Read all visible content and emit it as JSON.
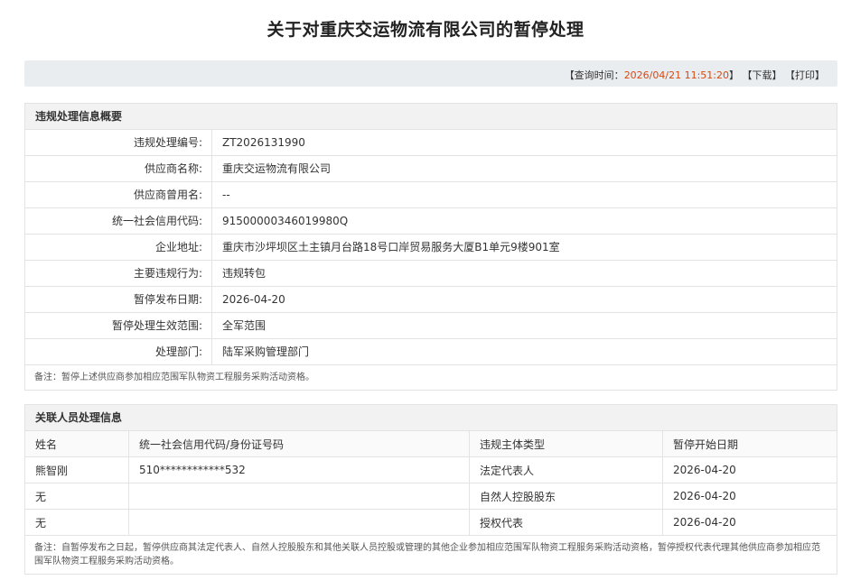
{
  "page": {
    "title": "关于对重庆交运物流有限公司的暂停处理"
  },
  "toolbar": {
    "query_label": "【查询时间：",
    "query_time": "2026/04/21 11:51:20",
    "query_close": "】",
    "download_label": "【下载】",
    "print_label": "【打印】"
  },
  "overview": {
    "heading": "违规处理信息概要",
    "rows": [
      {
        "label": "违规处理编号:",
        "value": "ZT2026131990"
      },
      {
        "label": "供应商名称:",
        "value": "重庆交运物流有限公司"
      },
      {
        "label": "供应商曾用名:",
        "value": "--"
      },
      {
        "label": "统一社会信用代码:",
        "value": "91500000346019980Q"
      },
      {
        "label": "企业地址:",
        "value": "重庆市沙坪坝区土主镇月台路18号口岸贸易服务大厦B1单元9楼901室"
      },
      {
        "label": "主要违规行为:",
        "value": "违规转包"
      },
      {
        "label": "暂停发布日期:",
        "value": "2026-04-20"
      },
      {
        "label": "暂停处理生效范围:",
        "value": "全军范围"
      },
      {
        "label": "处理部门:",
        "value": "陆军采购管理部门"
      }
    ],
    "note": "备注：暂停上述供应商参加相应范围军队物资工程服务采购活动资格。"
  },
  "persons": {
    "heading": "关联人员处理信息",
    "columns": [
      "姓名",
      "统一社会信用代码/身份证号码",
      "违规主体类型",
      "暂停开始日期"
    ],
    "rows": [
      {
        "name": "熊智刚",
        "id": "510************532",
        "type": "法定代表人",
        "date": "2026-04-20"
      },
      {
        "name": "无",
        "id": "",
        "type": "自然人控股股东",
        "date": "2026-04-20"
      },
      {
        "name": "无",
        "id": "",
        "type": "授权代表",
        "date": "2026-04-20"
      }
    ],
    "note": "备注：自暂停发布之日起，暂停供应商其法定代表人、自然人控股股东和其他关联人员控股或管理的其他企业参加相应范围军队物资工程服务采购活动资格，暂停授权代表代理其他供应商参加相应范围军队物资工程服务采购活动资格。"
  }
}
